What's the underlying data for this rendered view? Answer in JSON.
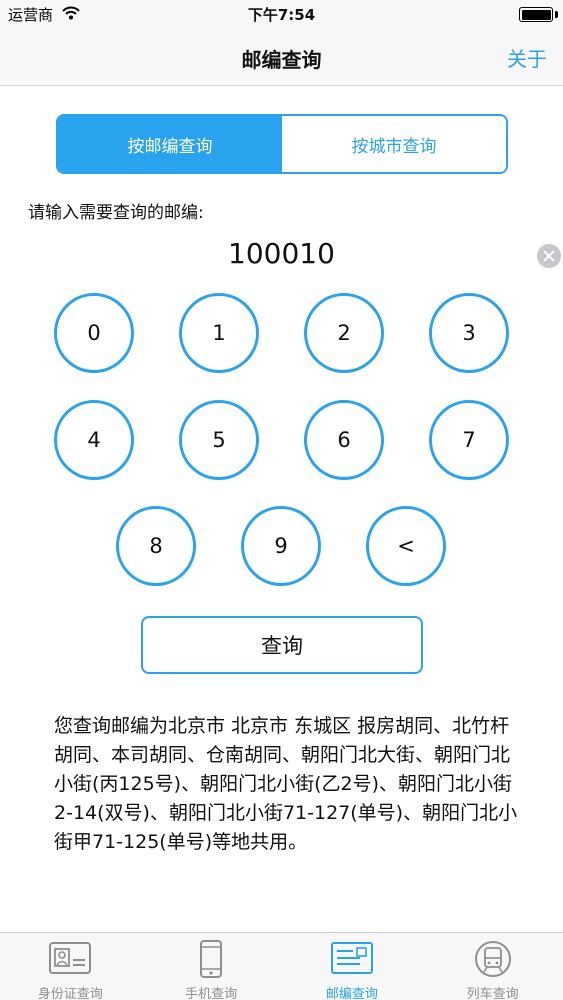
{
  "status_bar": {
    "carrier": "运营商",
    "time": "下午7:54"
  },
  "nav": {
    "title": "邮编查询",
    "right_button": "关于"
  },
  "segments": [
    {
      "label": "按邮编查询",
      "selected": true
    },
    {
      "label": "按城市查询",
      "selected": false
    }
  ],
  "prompt": "请输入需要查询的邮编:",
  "input": {
    "value": "100010"
  },
  "keypad": [
    "0",
    "1",
    "2",
    "3",
    "4",
    "5",
    "6",
    "7",
    "8",
    "9",
    "<"
  ],
  "query_button": "查询",
  "result_text": "您查询邮编为北京市 北京市 东城区 报房胡同、北竹杆胡同、本司胡同、仓南胡同、朝阳门北大街、朝阳门北小街(丙125号)、朝阳门北小街(乙2号)、朝阳门北小街2-14(双号)、朝阳门北小街71-127(单号)、朝阳门北小街甲71-125(单号)等地共用。",
  "tabs": [
    {
      "label": "身份证查询",
      "icon": "id-card-icon",
      "active": false
    },
    {
      "label": "手机查询",
      "icon": "phone-icon",
      "active": false
    },
    {
      "label": "邮编查询",
      "icon": "envelope-icon",
      "active": true
    },
    {
      "label": "列车查询",
      "icon": "train-icon",
      "active": false
    }
  ],
  "colors": {
    "accent": "#2aa3ef",
    "inactive": "#8e8e93"
  }
}
